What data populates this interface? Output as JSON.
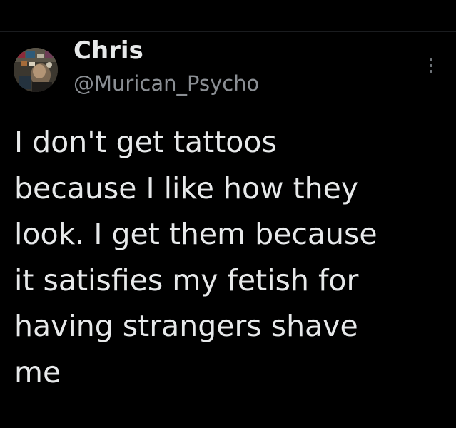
{
  "colors": {
    "background": "#000000",
    "primary_text": "#e7e9ea",
    "secondary_text": "#8b8f94",
    "icon_gray": "#71767b"
  },
  "author": {
    "display_name": "Chris",
    "handle": "@Murican_Psycho",
    "avatar_icon": "profile-photo"
  },
  "menu": {
    "more_icon": "more-options-vertical-icon"
  },
  "tweet": {
    "lines": [
      "I don't get tattoos",
      "because I like how they",
      "look. I get them because",
      "it satisfies my fetish for",
      "having strangers shave",
      "me"
    ]
  }
}
